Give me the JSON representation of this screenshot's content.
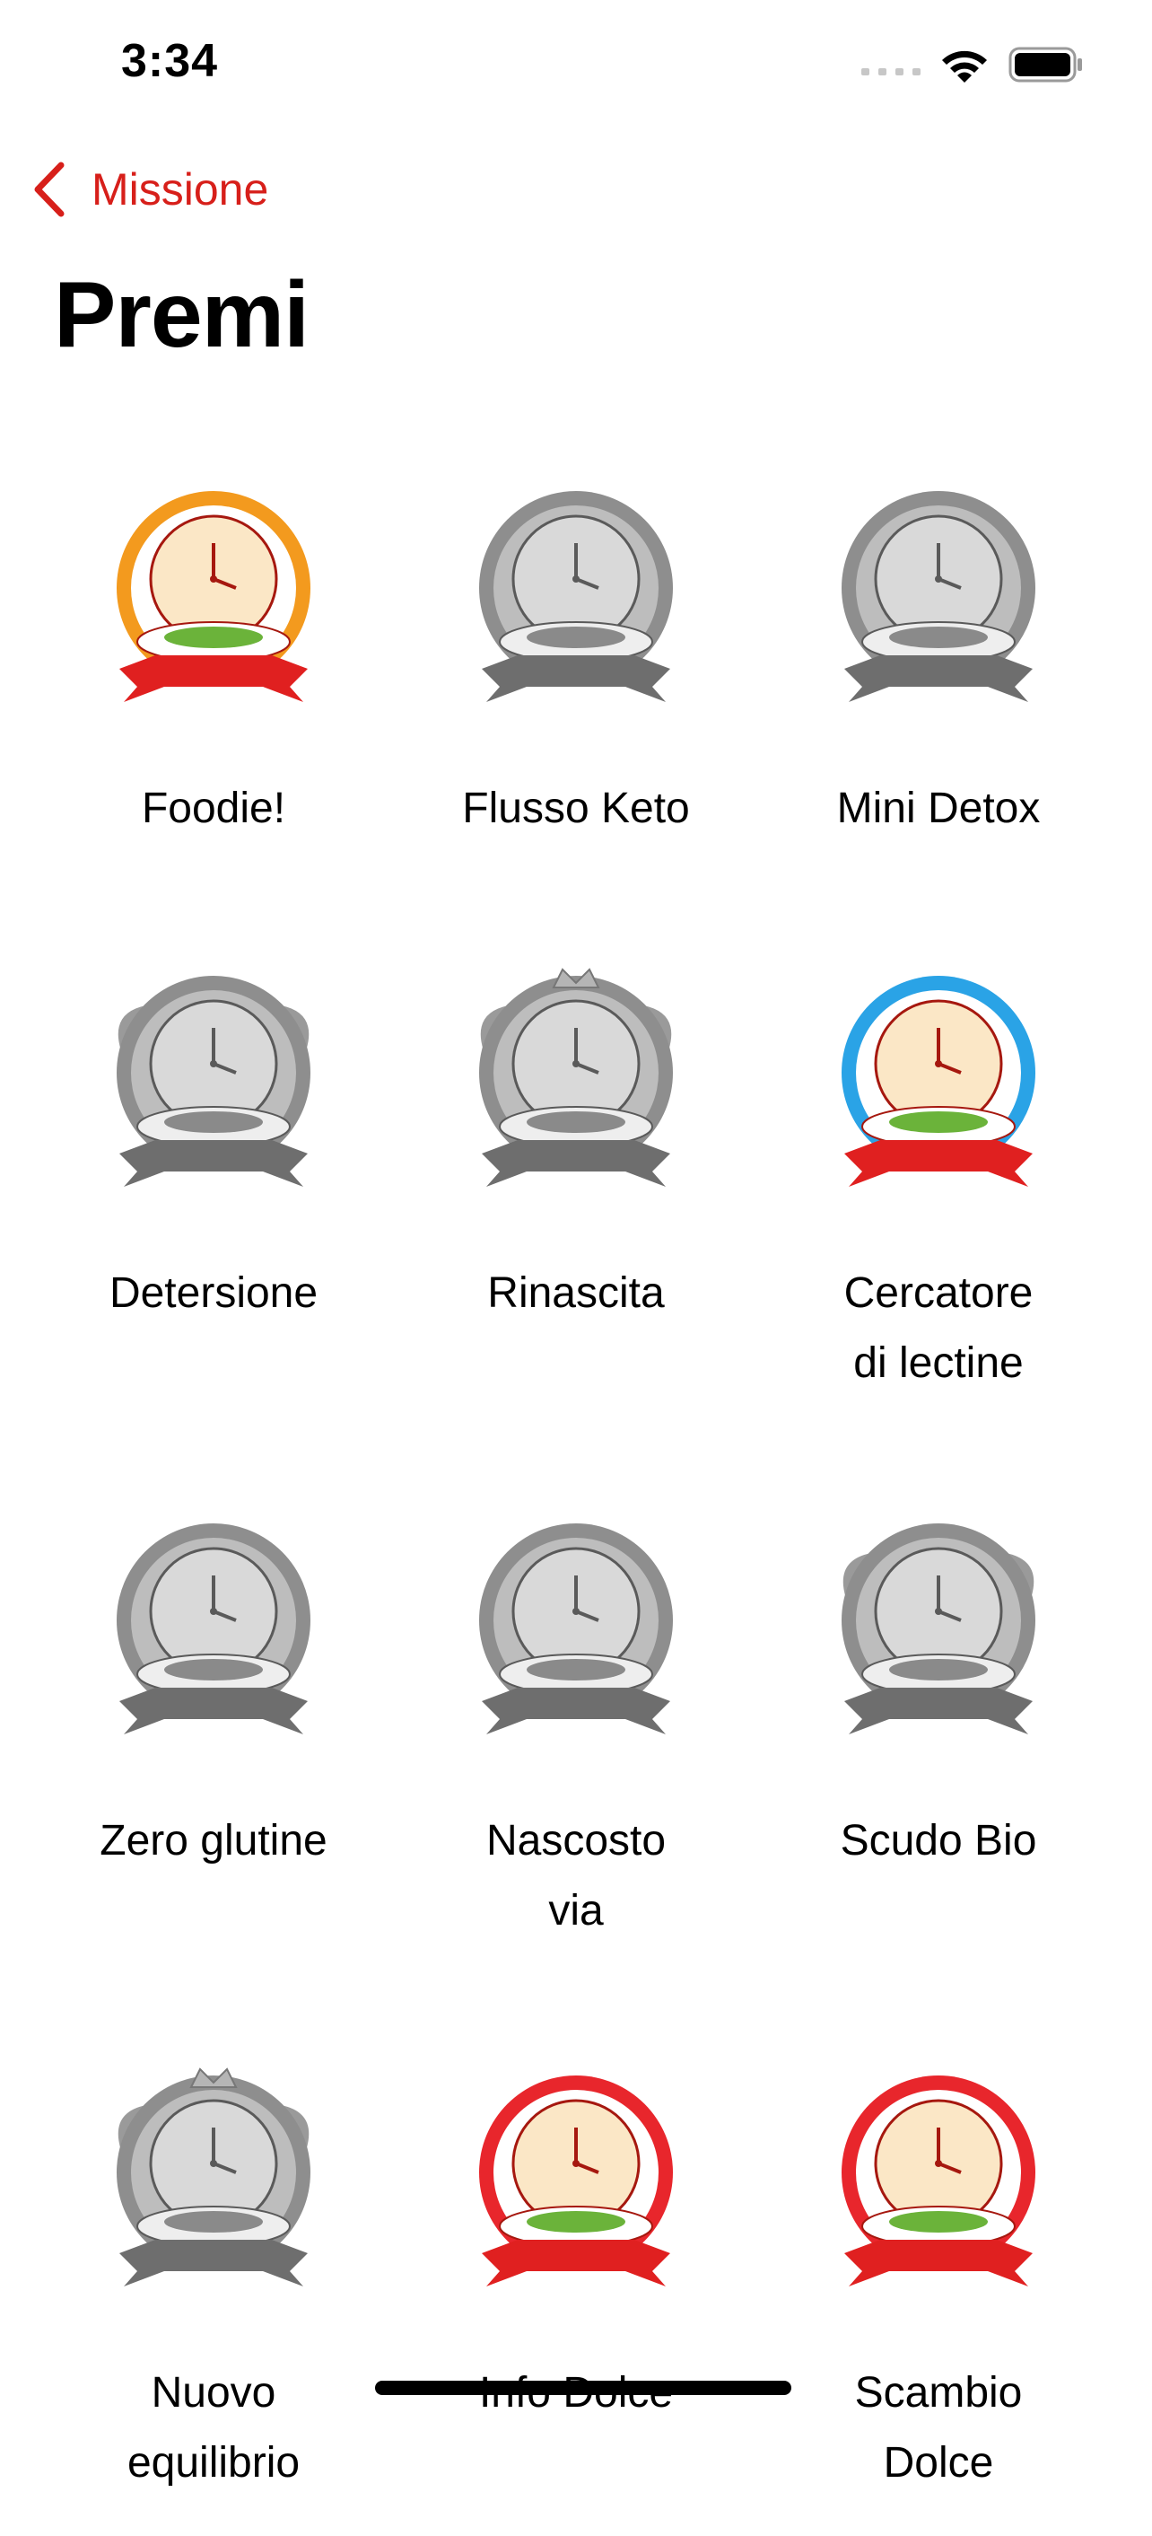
{
  "status_bar": {
    "time": "3:34"
  },
  "nav": {
    "back_label": "Missione"
  },
  "page": {
    "title": "Premi"
  },
  "badges": [
    {
      "label": "Foodie!",
      "earned": true,
      "theme": "clock-salad",
      "color": "#f39a1e"
    },
    {
      "label": "Flusso Keto",
      "earned": false,
      "theme": "clock-soup"
    },
    {
      "label": "Mini Detox",
      "earned": false,
      "theme": "clock-cake"
    },
    {
      "label": "Detersione",
      "earned": false,
      "theme": "winged-clock-plate"
    },
    {
      "label": "Rinascita",
      "earned": false,
      "theme": "winged-crown-clock"
    },
    {
      "label": "Cercatore\ndi lectine",
      "earned": true,
      "theme": "milk-nuts",
      "color": "#2aa3e6"
    },
    {
      "label": "Zero glutine",
      "earned": false,
      "theme": "milk-bread"
    },
    {
      "label": "Nascosto\nvia",
      "earned": false,
      "theme": "tomato-cheese"
    },
    {
      "label": "Scudo Bio",
      "earned": false,
      "theme": "winged-corn"
    },
    {
      "label": "Nuovo\nequilibrio",
      "earned": false,
      "theme": "winged-crown"
    },
    {
      "label": "Info Dolce",
      "earned": true,
      "theme": "sweets-donut",
      "color": "#e8262c"
    },
    {
      "label": "Scambio\nDolce",
      "earned": true,
      "theme": "soda-chocolate",
      "color": "#e8262c"
    }
  ]
}
